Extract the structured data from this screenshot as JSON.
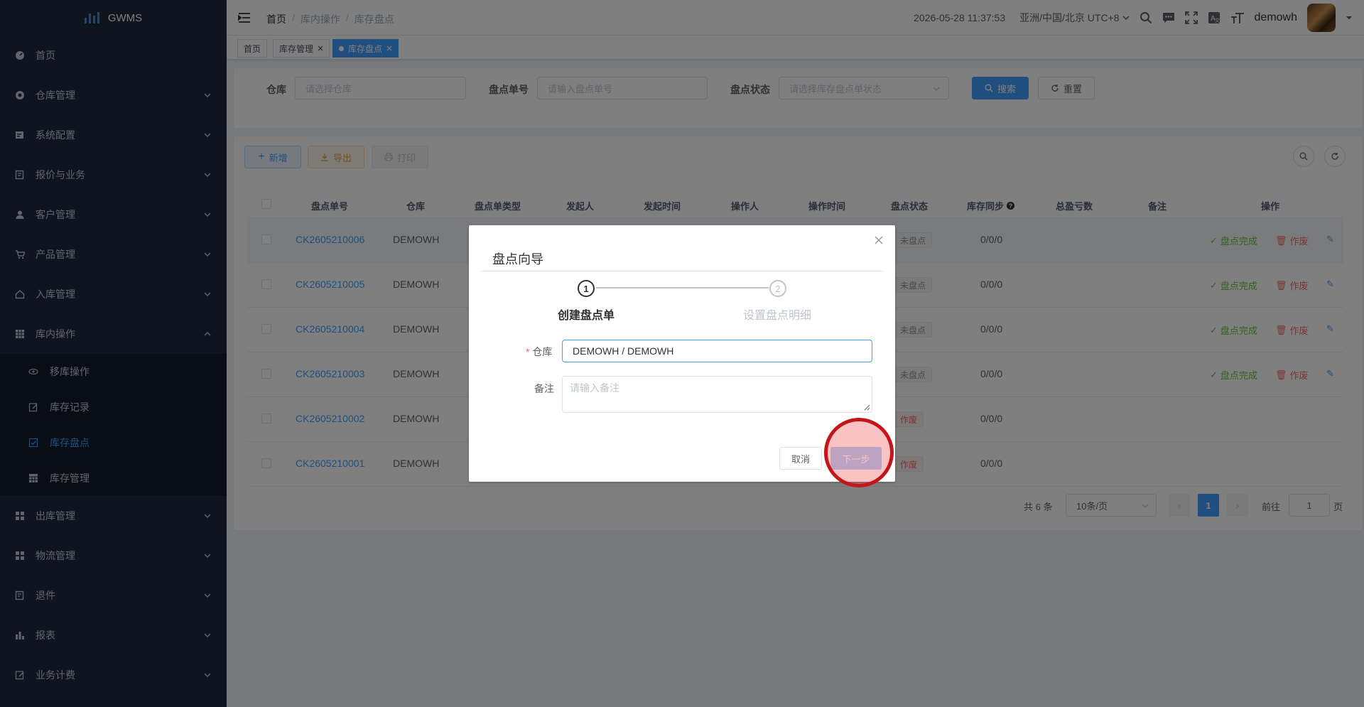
{
  "app": {
    "name": "GWMS"
  },
  "sidebar": {
    "items": [
      {
        "label": "首页",
        "icon": "dashboard-icon"
      },
      {
        "label": "仓库管理",
        "icon": "warehouse-icon"
      },
      {
        "label": "系统配置",
        "icon": "system-config-icon"
      },
      {
        "label": "报价与业务",
        "icon": "quote-icon"
      },
      {
        "label": "客户管理",
        "icon": "user-icon"
      },
      {
        "label": "产品管理",
        "icon": "cart-icon"
      },
      {
        "label": "入库管理",
        "icon": "home-icon"
      },
      {
        "label": "库内操作",
        "icon": "grid-icon"
      }
    ],
    "subitems": [
      {
        "label": "移库操作",
        "icon": "eye-icon"
      },
      {
        "label": "库存记录",
        "icon": "edit-icon"
      },
      {
        "label": "库存盘点",
        "icon": "checkbox-icon"
      },
      {
        "label": "库存管理",
        "icon": "table-icon"
      }
    ],
    "items_after": [
      {
        "label": "出库管理",
        "icon": "apps-icon"
      },
      {
        "label": "物流管理",
        "icon": "apps-icon"
      },
      {
        "label": "退件",
        "icon": "return-icon"
      },
      {
        "label": "报表",
        "icon": "chart-icon"
      },
      {
        "label": "业务计费",
        "icon": "billing-icon"
      }
    ]
  },
  "header": {
    "breadcrumb": [
      "首页",
      "库内操作",
      "库存盘点"
    ],
    "datetime": "2026-05-28 11:37:53",
    "timezone": "亚洲/中国/北京 UTC+8",
    "username": "demowh"
  },
  "tags": [
    "首页",
    "库存管理",
    "库存盘点"
  ],
  "search": {
    "warehouse_label": "仓库",
    "warehouse_placeholder": "请选择仓库",
    "order_label": "盘点单号",
    "order_placeholder": "请输入盘点单号",
    "status_label": "盘点状态",
    "status_placeholder": "请选择库存盘点单状态",
    "search_btn": "搜索",
    "reset_btn": "重置"
  },
  "toolbar": {
    "add": "新增",
    "export": "导出",
    "print": "打印"
  },
  "table": {
    "headers": [
      "盘点单号",
      "仓库",
      "盘点单类型",
      "发起人",
      "发起时间",
      "操作人",
      "操作时间",
      "盘点状态",
      "库存同步",
      "总盈亏数",
      "备注",
      "操作"
    ],
    "rows": [
      {
        "no": "CK2605210006",
        "wh": "DEMOWH",
        "status": "未盘点",
        "sync": "0/0/0",
        "actions": true
      },
      {
        "no": "CK2605210005",
        "wh": "DEMOWH",
        "status": "未盘点",
        "sync": "0/0/0",
        "actions": true
      },
      {
        "no": "CK2605210004",
        "wh": "DEMOWH",
        "status": "未盘点",
        "sync": "0/0/0",
        "actions": true
      },
      {
        "no": "CK2605210003",
        "wh": "DEMOWH",
        "status": "未盘点",
        "sync": "0/0/0",
        "actions": true
      },
      {
        "no": "CK2605210002",
        "wh": "DEMOWH",
        "status": "作废",
        "sync": "0/0/0",
        "actions": false
      },
      {
        "no": "CK2605210001",
        "wh": "DEMOWH",
        "status": "作废",
        "sync": "0/0/0",
        "actions": false
      }
    ],
    "op_complete": "盘点完成",
    "op_void": "作废"
  },
  "pagination": {
    "total": "共 6 条",
    "page_size": "10条/页",
    "current": "1",
    "goto_label": "前往",
    "goto_value": "1",
    "page_unit": "页"
  },
  "dialog": {
    "title": "盘点向导",
    "step1_num": "1",
    "step1_title": "创建盘点单",
    "step2_num": "2",
    "step2_title": "设置盘点明细",
    "warehouse_label": "仓库",
    "warehouse_value": "DEMOWH / DEMOWH",
    "remark_label": "备注",
    "remark_placeholder": "请输入备注",
    "cancel": "取消",
    "next": "下一步"
  }
}
